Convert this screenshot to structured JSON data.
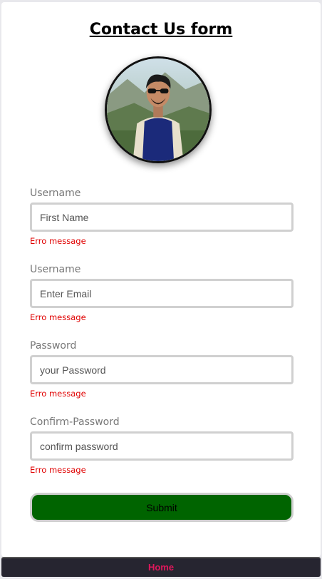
{
  "form": {
    "title": "Contact Us form",
    "fields": [
      {
        "label": "Username",
        "placeholder": "First Name",
        "error": "Erro message"
      },
      {
        "label": "Username",
        "placeholder": "Enter Email",
        "error": "Erro message"
      },
      {
        "label": "Password",
        "placeholder": "your Password",
        "error": "Erro message"
      },
      {
        "label": "Confirm-Password",
        "placeholder": "confirm password",
        "error": "Erro message"
      }
    ],
    "submit_label": "Submit"
  },
  "nav": {
    "home_label": "Home"
  },
  "colors": {
    "submit_bg": "#006400",
    "error": "#e00000",
    "nav_bg": "#262530",
    "nav_link": "#e0185c"
  }
}
